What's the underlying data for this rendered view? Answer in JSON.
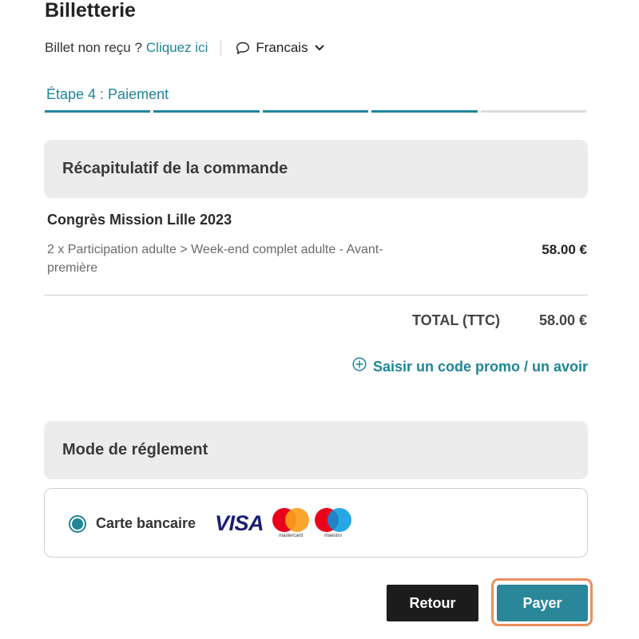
{
  "page": {
    "title": "Billetterie"
  },
  "header": {
    "not_received_text": "Billet non reçu ?",
    "click_here_link": "Cliquez ici",
    "language": "Francais",
    "language_icon": "speech-bubble-icon",
    "language_chevron_icon": "chevron-down-icon"
  },
  "steps": {
    "label": "Étape 4 : Paiement",
    "current": 4,
    "total": 5
  },
  "summary": {
    "title": "Récapitulatif de la commande",
    "event_name": "Congrès Mission Lille 2023",
    "items": [
      {
        "description": "2 x Participation adulte > Week-end complet adulte - Avant-première",
        "price": "58.00 €"
      }
    ],
    "total_label": "TOTAL (TTC)",
    "total_value": "58.00 €",
    "promo_label": "Saisir un code promo / un avoir",
    "promo_icon": "plus-circle-icon"
  },
  "payment": {
    "title": "Mode de réglement",
    "method_label": "Carte bancaire",
    "selected": true,
    "card_logos": [
      {
        "name": "visa-logo",
        "text": "VISA"
      },
      {
        "name": "mastercard-logo",
        "caption": "mastercard"
      },
      {
        "name": "maestro-logo",
        "caption": "maestro"
      }
    ]
  },
  "actions": {
    "back_label": "Retour",
    "pay_label": "Payer"
  },
  "colors": {
    "accent": "#1f8597",
    "pay_button": "#2a8799",
    "back_button": "#1c1c1c",
    "focus_ring": "#e98f5c",
    "panel_header_bg": "#ececec"
  }
}
